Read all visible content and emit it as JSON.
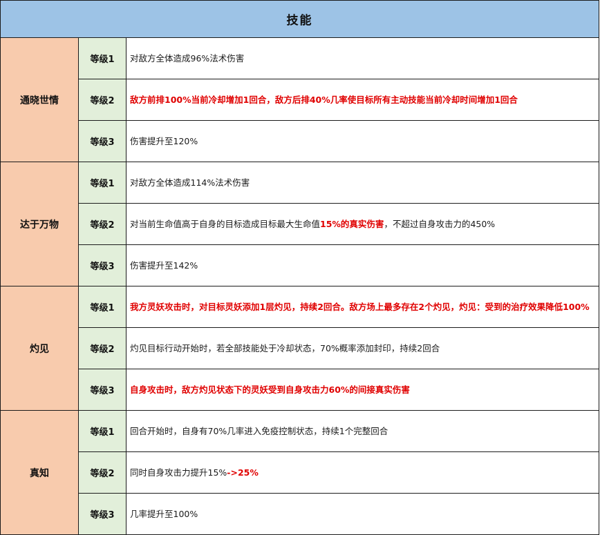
{
  "title": "技能",
  "colors": {
    "title_bg": "#9dc3e6",
    "skill_bg": "#f8cbad",
    "level_bg": "#e2efda",
    "highlight": "#e00000"
  },
  "skills": [
    {
      "name": "通晓世情",
      "levels": [
        {
          "label": "等级1",
          "segments": [
            {
              "text": "对敌方全体造成96%法术伤害",
              "red": false
            }
          ]
        },
        {
          "label": "等级2",
          "segments": [
            {
              "text": "敌方前排100%当前冷却增加1回合，敌方后排40%几率使目标所有主动技能当前冷却时间增加1回合",
              "red": true
            }
          ]
        },
        {
          "label": "等级3",
          "segments": [
            {
              "text": "伤害提升至120%",
              "red": false
            }
          ]
        }
      ]
    },
    {
      "name": "达于万物",
      "levels": [
        {
          "label": "等级1",
          "segments": [
            {
              "text": "对敌方全体造成114%法术伤害",
              "red": false
            }
          ]
        },
        {
          "label": "等级2",
          "segments": [
            {
              "text": "对当前生命值高于自身的目标造成目标最大生命值",
              "red": false
            },
            {
              "text": "15%的真实伤害",
              "red": true
            },
            {
              "text": "，不超过自身攻击力的450%",
              "red": false
            }
          ]
        },
        {
          "label": "等级3",
          "segments": [
            {
              "text": "伤害提升至142%",
              "red": false
            }
          ]
        }
      ]
    },
    {
      "name": "灼见",
      "levels": [
        {
          "label": "等级1",
          "segments": [
            {
              "text": "我方灵妖攻击时，对目标灵妖添加1层灼见，持续2回合。敌方场上最多存在2个灼见，灼见：受到的治疗效果降低100%",
              "red": true
            }
          ]
        },
        {
          "label": "等级2",
          "segments": [
            {
              "text": "灼见目标行动开始时，若全部技能处于冷却状态，70%概率添加封印，持续2回合",
              "red": false
            }
          ]
        },
        {
          "label": "等级3",
          "segments": [
            {
              "text": "自身攻击时，敌方灼见状态下的灵妖受到自身攻击力60%的间接真实伤害",
              "red": true
            }
          ]
        }
      ]
    },
    {
      "name": "真知",
      "levels": [
        {
          "label": "等级1",
          "segments": [
            {
              "text": "回合开始时，自身有70%几率进入免疫控制状态，持续1个完整回合",
              "red": false
            }
          ]
        },
        {
          "label": "等级2",
          "segments": [
            {
              "text": "同时自身攻击力提升15%",
              "red": false
            },
            {
              "text": "->25%",
              "red": true
            }
          ]
        },
        {
          "label": "等级3",
          "segments": [
            {
              "text": "几率提升至100%",
              "red": false
            }
          ]
        }
      ]
    }
  ]
}
